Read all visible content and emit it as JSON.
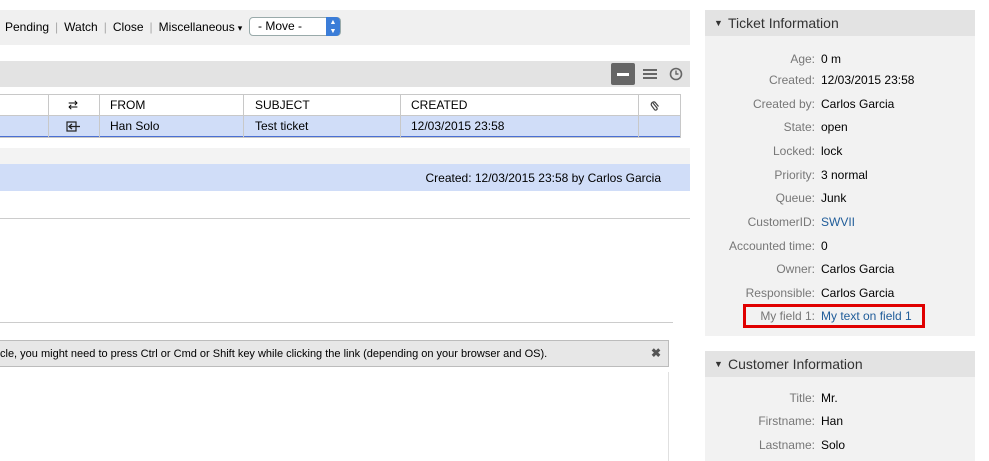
{
  "actionbar": {
    "items": [
      "Pending",
      "Watch",
      "Close",
      "Miscellaneous"
    ],
    "misc_caret": "▾",
    "move_select_value": "- Move -"
  },
  "ticket_table": {
    "headers": [
      "",
      "⇄",
      "FROM",
      "SUBJECT",
      "CREATED",
      ""
    ],
    "row": {
      "from": "Han Solo",
      "subject": "Test ticket",
      "created": "12/03/2015 23:58"
    }
  },
  "article": {
    "created_text": "Created: 12/03/2015 23:58 by Carlos Garcia",
    "notice_text": "cle, you might need to press Ctrl or Cmd or Shift key while clicking the link (depending on your browser and OS).",
    "notice_close": "✖"
  },
  "ticket_info": {
    "title": "Ticket Information",
    "rows": [
      {
        "label": "Age:",
        "value": "0 m"
      },
      {
        "label": "Created:",
        "value": "12/03/2015 23:58"
      },
      {
        "label": "Created by:",
        "value": "Carlos Garcia"
      },
      {
        "label": "State:",
        "value": "open"
      },
      {
        "label": "Locked:",
        "value": "lock"
      },
      {
        "label": "Priority:",
        "value": "3 normal"
      },
      {
        "label": "Queue:",
        "value": "Junk"
      },
      {
        "label": "CustomerID:",
        "value": "SWVII"
      },
      {
        "label": "Accounted time:",
        "value": "0"
      },
      {
        "label": "Owner:",
        "value": "Carlos Garcia"
      },
      {
        "label": "Responsible:",
        "value": "Carlos Garcia"
      },
      {
        "label": "My field 1:",
        "value": "My text on field 1"
      }
    ]
  },
  "customer_info": {
    "title": "Customer Information",
    "rows": [
      {
        "label": "Title:",
        "value": "Mr."
      },
      {
        "label": "Firstname:",
        "value": "Han"
      },
      {
        "label": "Lastname:",
        "value": "Solo"
      }
    ]
  },
  "colors": {
    "highlight_box": "#e00000",
    "link": "#1f5c99",
    "selected_row": "#d0ddf8"
  }
}
